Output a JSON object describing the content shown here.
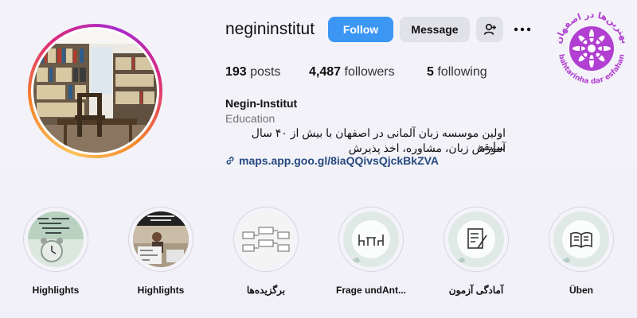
{
  "profile": {
    "username": "negininstitut",
    "follow_label": "Follow",
    "message_label": "Message",
    "stats": {
      "posts_count": "193",
      "posts_label": "posts",
      "followers_count": "4,487",
      "followers_label": "followers",
      "following_count": "5",
      "following_label": "following"
    },
    "bio": {
      "name": "Negin-Institut",
      "category": "Education",
      "line1": "اولین موسسه زبان آلمانی در اصفهان با بیش از ۴۰ سال سابقه",
      "line2": "آموزش زبان، مشاوره، اخذ پذیرش",
      "link": "maps.app.goo.gl/8iaQQivsQjckBkZVA"
    },
    "logo_text_top": "بهترین‌ها در اصفهان",
    "logo_text_bottom": "bahtarinha dar esfahan",
    "colors": {
      "follow": "#3b97f3",
      "link": "#264a80",
      "logo": "#b13fd1"
    }
  },
  "highlights": [
    {
      "label": "Highlights",
      "icon": "alarm-clock-photo"
    },
    {
      "label": "Highlights",
      "icon": "classroom-photo"
    },
    {
      "label": "برگزیده‌ها",
      "icon": "diagram-photo"
    },
    {
      "label": "Frage undAnt...",
      "icon": "table-chairs-icon"
    },
    {
      "label": "آمادگی آزمون",
      "icon": "exam-paper-icon"
    },
    {
      "label": "Üben",
      "icon": "open-book-icon"
    }
  ]
}
